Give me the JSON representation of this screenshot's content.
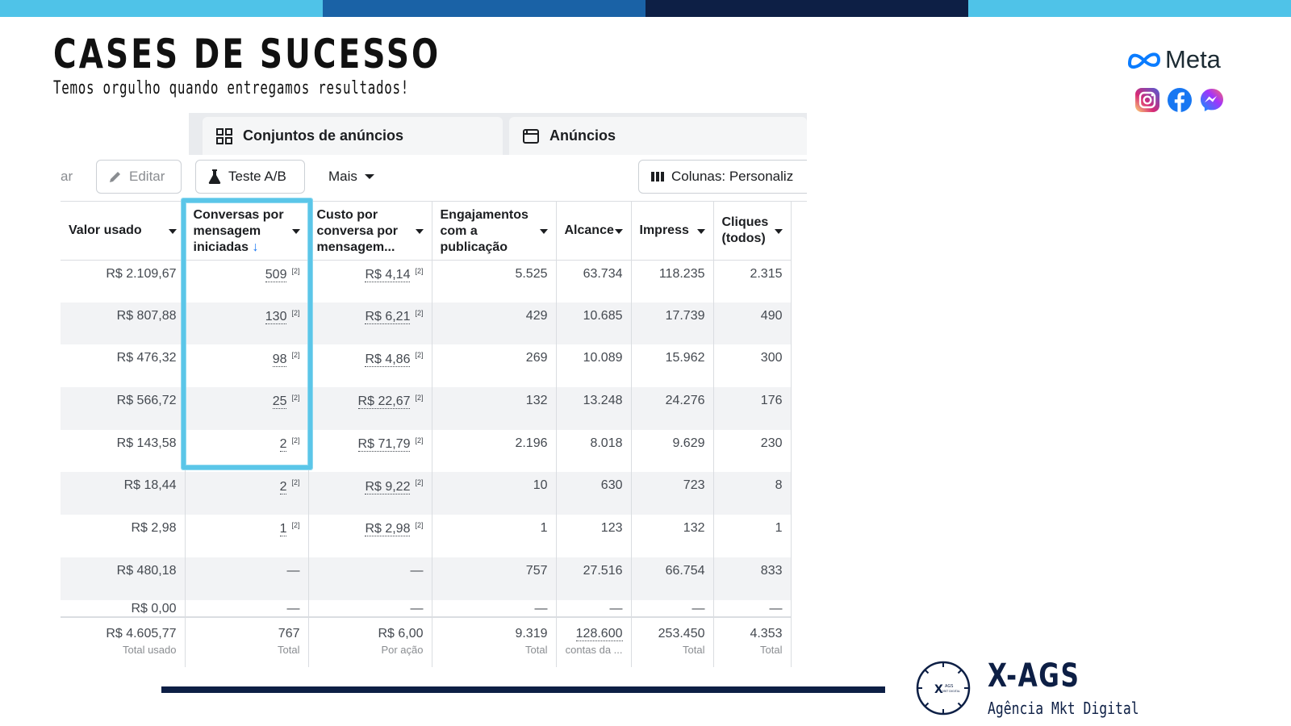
{
  "colors": {
    "bar1": "#4fc3e8",
    "bar2": "#1a62a6",
    "bar3": "#0d1f45",
    "bar4": "#4fc3e8",
    "highlight": "#5bc6e8",
    "navy": "#0d1f45"
  },
  "slide": {
    "title": "CASES DE SUCESSO",
    "subtitle": "Temos orgulho quando entregamos resultados!"
  },
  "meta": {
    "logo_text": "Meta",
    "icons": [
      "instagram-icon",
      "facebook-icon",
      "messenger-icon"
    ]
  },
  "tabs": [
    {
      "label": "Conjuntos de anúncios",
      "icon": "grid-icon"
    },
    {
      "label": "Anúncios",
      "icon": "ad-window-icon"
    }
  ],
  "toolbar": {
    "partial_label": "ar",
    "edit_label": "Editar",
    "ab_label": "Teste A/B",
    "more_label": "Mais",
    "columns_label": "Colunas: Personaliz"
  },
  "table": {
    "headers": [
      "Valor usado",
      "Conversas por mensagem iniciadas",
      "Custo por conversa por mensagem...",
      "Engajamentos com a publicação",
      "Alcance",
      "Impress",
      "Cliques (todos)"
    ],
    "rows": [
      [
        "R$ 2.109,67",
        "509",
        "R$ 4,14",
        "5.525",
        "63.734",
        "118.235",
        "2.315"
      ],
      [
        "R$ 807,88",
        "130",
        "R$ 6,21",
        "429",
        "10.685",
        "17.739",
        "490"
      ],
      [
        "R$ 476,32",
        "98",
        "R$ 4,86",
        "269",
        "10.089",
        "15.962",
        "300"
      ],
      [
        "R$ 566,72",
        "25",
        "R$ 22,67",
        "132",
        "13.248",
        "24.276",
        "176"
      ],
      [
        "R$ 143,58",
        "2",
        "R$ 71,79",
        "2.196",
        "8.018",
        "9.629",
        "230"
      ],
      [
        "R$ 18,44",
        "2",
        "R$ 9,22",
        "10",
        "630",
        "723",
        "8"
      ],
      [
        "R$ 2,98",
        "1",
        "R$ 2,98",
        "1",
        "123",
        "132",
        "1"
      ],
      [
        "R$ 480,18",
        "—",
        "—",
        "757",
        "27.516",
        "66.754",
        "833"
      ],
      [
        "R$ 0,00",
        "—",
        "—",
        "—",
        "—",
        "—",
        "—"
      ]
    ],
    "footnote_mark": "[2]",
    "totals": [
      {
        "value": "R$ 4.605,77",
        "label": "Total usado"
      },
      {
        "value": "767",
        "label": "Total"
      },
      {
        "value": "R$ 6,00",
        "label": "Por ação"
      },
      {
        "value": "9.319",
        "label": "Total"
      },
      {
        "value": "128.600",
        "label": "contas da ..."
      },
      {
        "value": "253.450",
        "label": "Total"
      },
      {
        "value": "4.353",
        "label": "Total"
      }
    ]
  },
  "brand": {
    "name": "X-AGS",
    "tagline": "Agência Mkt Digital",
    "logo_mark": "X",
    "logo_small": "AGS",
    "logo_sub": "MKT DIGITAL"
  }
}
